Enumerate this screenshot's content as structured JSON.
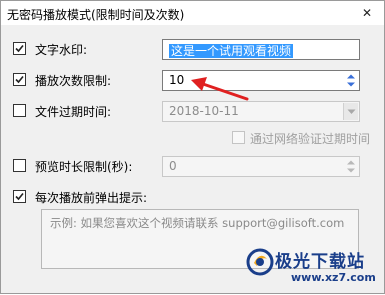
{
  "window": {
    "title": "无密码播放模式(限制时间及次数)",
    "close_glyph": "✕"
  },
  "watermark": {
    "label": "文字水印:",
    "checked": true,
    "value": "这是一个试用观看视频"
  },
  "play_limit": {
    "label": "播放次数限制:",
    "checked": true,
    "value": "10"
  },
  "expire": {
    "label": "文件过期时间:",
    "checked": false,
    "date": "2018-10-11",
    "network_verify_label": "通过网络验证过期时间",
    "network_verify_checked": false
  },
  "preview": {
    "label": "预览时长限制(秒):",
    "checked": false,
    "value": "0"
  },
  "popup": {
    "label": "每次播放前弹出提示:",
    "checked": true,
    "placeholder": "示例: 如果您喜欢这个视频请联系 support@gilisoft.com"
  },
  "logo": {
    "text": "极光下载站",
    "url": "www.xz7.com"
  },
  "colors": {
    "selection": "#3399ff",
    "arrow": "#e02020",
    "logo": "#1a3e8a"
  }
}
